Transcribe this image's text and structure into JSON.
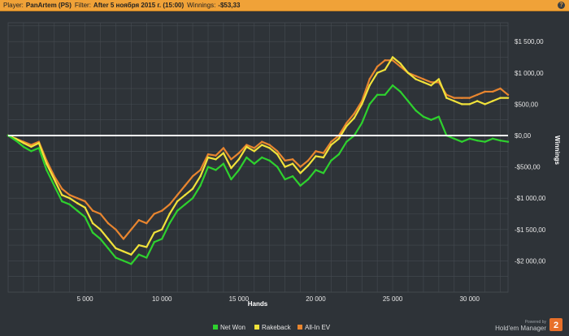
{
  "header": {
    "player_label": "Player:",
    "player_value": "PanArtem (PS)",
    "filter_label": "Filter:",
    "filter_value": "After 5 ноября 2015 г. (15:00)",
    "winnings_label": "Winnings:",
    "winnings_value": "-$53,33",
    "help_glyph": "?"
  },
  "branding": {
    "powered_by": "Powered by",
    "product": "Hold'em Manager",
    "badge": "2"
  },
  "colors": {
    "header_bg": "#f0a238",
    "background": "#2e3338",
    "grid": "#454b51",
    "zero_line": "#ffffff",
    "net_won": "#2ed12e",
    "rakeback": "#f0e23a",
    "all_in_ev": "#e8852f"
  },
  "chart_data": {
    "type": "line",
    "xlabel": "Hands",
    "ylabel": "Winnings",
    "xlim": [
      0,
      32500
    ],
    "ylim": [
      -2500,
      1800
    ],
    "x_ticks": [
      5000,
      10000,
      15000,
      20000,
      25000,
      30000
    ],
    "x_tick_labels": [
      "5 000",
      "10 000",
      "15 000",
      "20 000",
      "25 000",
      "30 000"
    ],
    "y_ticks": [
      1500,
      1000,
      500,
      0,
      -500,
      -1000,
      -1500,
      -2000
    ],
    "y_tick_labels": [
      "$1 500,00",
      "$1 000,00",
      "$500,00",
      "$0,00",
      "-$500,00",
      "-$1 000,00",
      "-$1 500,00",
      "-$2 000,00"
    ],
    "y_axis_side": "right",
    "grid": true,
    "legend_position": "bottom",
    "series": [
      {
        "name": "Net Won",
        "color": "#2ed12e",
        "x": [
          0,
          500,
          1000,
          1500,
          2000,
          2500,
          3000,
          3500,
          4000,
          4500,
          5000,
          5500,
          6000,
          6500,
          7000,
          7500,
          8000,
          8500,
          9000,
          9500,
          10000,
          10500,
          11000,
          11500,
          12000,
          12500,
          13000,
          13500,
          14000,
          14500,
          15000,
          15500,
          16000,
          16500,
          17000,
          17500,
          18000,
          18500,
          19000,
          19500,
          20000,
          20500,
          21000,
          21500,
          22000,
          22500,
          23000,
          23500,
          24000,
          24500,
          25000,
          25500,
          26000,
          26500,
          27000,
          27500,
          28000,
          28500,
          29000,
          29500,
          30000,
          30500,
          31000,
          31500,
          32000,
          32500
        ],
        "y": [
          0,
          -80,
          -180,
          -250,
          -200,
          -550,
          -800,
          -1050,
          -1100,
          -1200,
          -1300,
          -1550,
          -1650,
          -1800,
          -1950,
          -2000,
          -2050,
          -1900,
          -1950,
          -1700,
          -1650,
          -1400,
          -1200,
          -1100,
          -1000,
          -800,
          -500,
          -550,
          -450,
          -700,
          -550,
          -350,
          -450,
          -350,
          -400,
          -500,
          -700,
          -650,
          -800,
          -700,
          -550,
          -600,
          -400,
          -300,
          -100,
          0,
          200,
          500,
          650,
          650,
          800,
          700,
          550,
          400,
          300,
          250,
          300,
          0,
          -50,
          -100,
          -50,
          -80,
          -100,
          -50,
          -80,
          -100
        ]
      },
      {
        "name": "Rakeback",
        "color": "#f0e23a",
        "x": [
          0,
          500,
          1000,
          1500,
          2000,
          2500,
          3000,
          3500,
          4000,
          4500,
          5000,
          5500,
          6000,
          6500,
          7000,
          7500,
          8000,
          8500,
          9000,
          9500,
          10000,
          10500,
          11000,
          11500,
          12000,
          12500,
          13000,
          13500,
          14000,
          14500,
          15000,
          15500,
          16000,
          16500,
          17000,
          17500,
          18000,
          18500,
          19000,
          19500,
          20000,
          20500,
          21000,
          21500,
          22000,
          22500,
          23000,
          23500,
          24000,
          24500,
          25000,
          25500,
          26000,
          26500,
          27000,
          27500,
          28000,
          28500,
          29000,
          29500,
          30000,
          30500,
          31000,
          31500,
          32000,
          32500
        ],
        "y": [
          0,
          -50,
          -120,
          -180,
          -120,
          -450,
          -700,
          -950,
          -1000,
          -1080,
          -1150,
          -1400,
          -1500,
          -1650,
          -1800,
          -1850,
          -1900,
          -1750,
          -1780,
          -1550,
          -1500,
          -1250,
          -1050,
          -950,
          -850,
          -650,
          -350,
          -380,
          -280,
          -520,
          -380,
          -180,
          -250,
          -150,
          -200,
          -300,
          -500,
          -450,
          -600,
          -480,
          -330,
          -350,
          -150,
          -50,
          150,
          280,
          500,
          800,
          1000,
          1050,
          1250,
          1150,
          1000,
          900,
          850,
          800,
          900,
          600,
          550,
          500,
          500,
          550,
          500,
          550,
          600,
          600
        ]
      },
      {
        "name": "All-In EV",
        "color": "#e8852f",
        "x": [
          0,
          500,
          1000,
          1500,
          2000,
          2500,
          3000,
          3500,
          4000,
          4500,
          5000,
          5500,
          6000,
          6500,
          7000,
          7500,
          8000,
          8500,
          9000,
          9500,
          10000,
          10500,
          11000,
          11500,
          12000,
          12500,
          13000,
          13500,
          14000,
          14500,
          15000,
          15500,
          16000,
          16500,
          17000,
          17500,
          18000,
          18500,
          19000,
          19500,
          20000,
          20500,
          21000,
          21500,
          22000,
          22500,
          23000,
          23500,
          24000,
          24500,
          25000,
          25500,
          26000,
          26500,
          27000,
          27500,
          28000,
          28500,
          29000,
          29500,
          30000,
          30500,
          31000,
          31500,
          32000,
          32500
        ],
        "y": [
          0,
          -50,
          -100,
          -150,
          -100,
          -400,
          -650,
          -850,
          -950,
          -1000,
          -1050,
          -1200,
          -1250,
          -1400,
          -1500,
          -1650,
          -1500,
          -1350,
          -1400,
          -1250,
          -1200,
          -1100,
          -950,
          -800,
          -650,
          -550,
          -300,
          -320,
          -200,
          -380,
          -280,
          -150,
          -200,
          -100,
          -150,
          -250,
          -400,
          -380,
          -500,
          -400,
          -250,
          -280,
          -100,
          0,
          200,
          350,
          550,
          900,
          1100,
          1200,
          1200,
          1100,
          1000,
          950,
          900,
          850,
          850,
          650,
          600,
          600,
          600,
          650,
          700,
          700,
          750,
          650
        ]
      }
    ]
  }
}
